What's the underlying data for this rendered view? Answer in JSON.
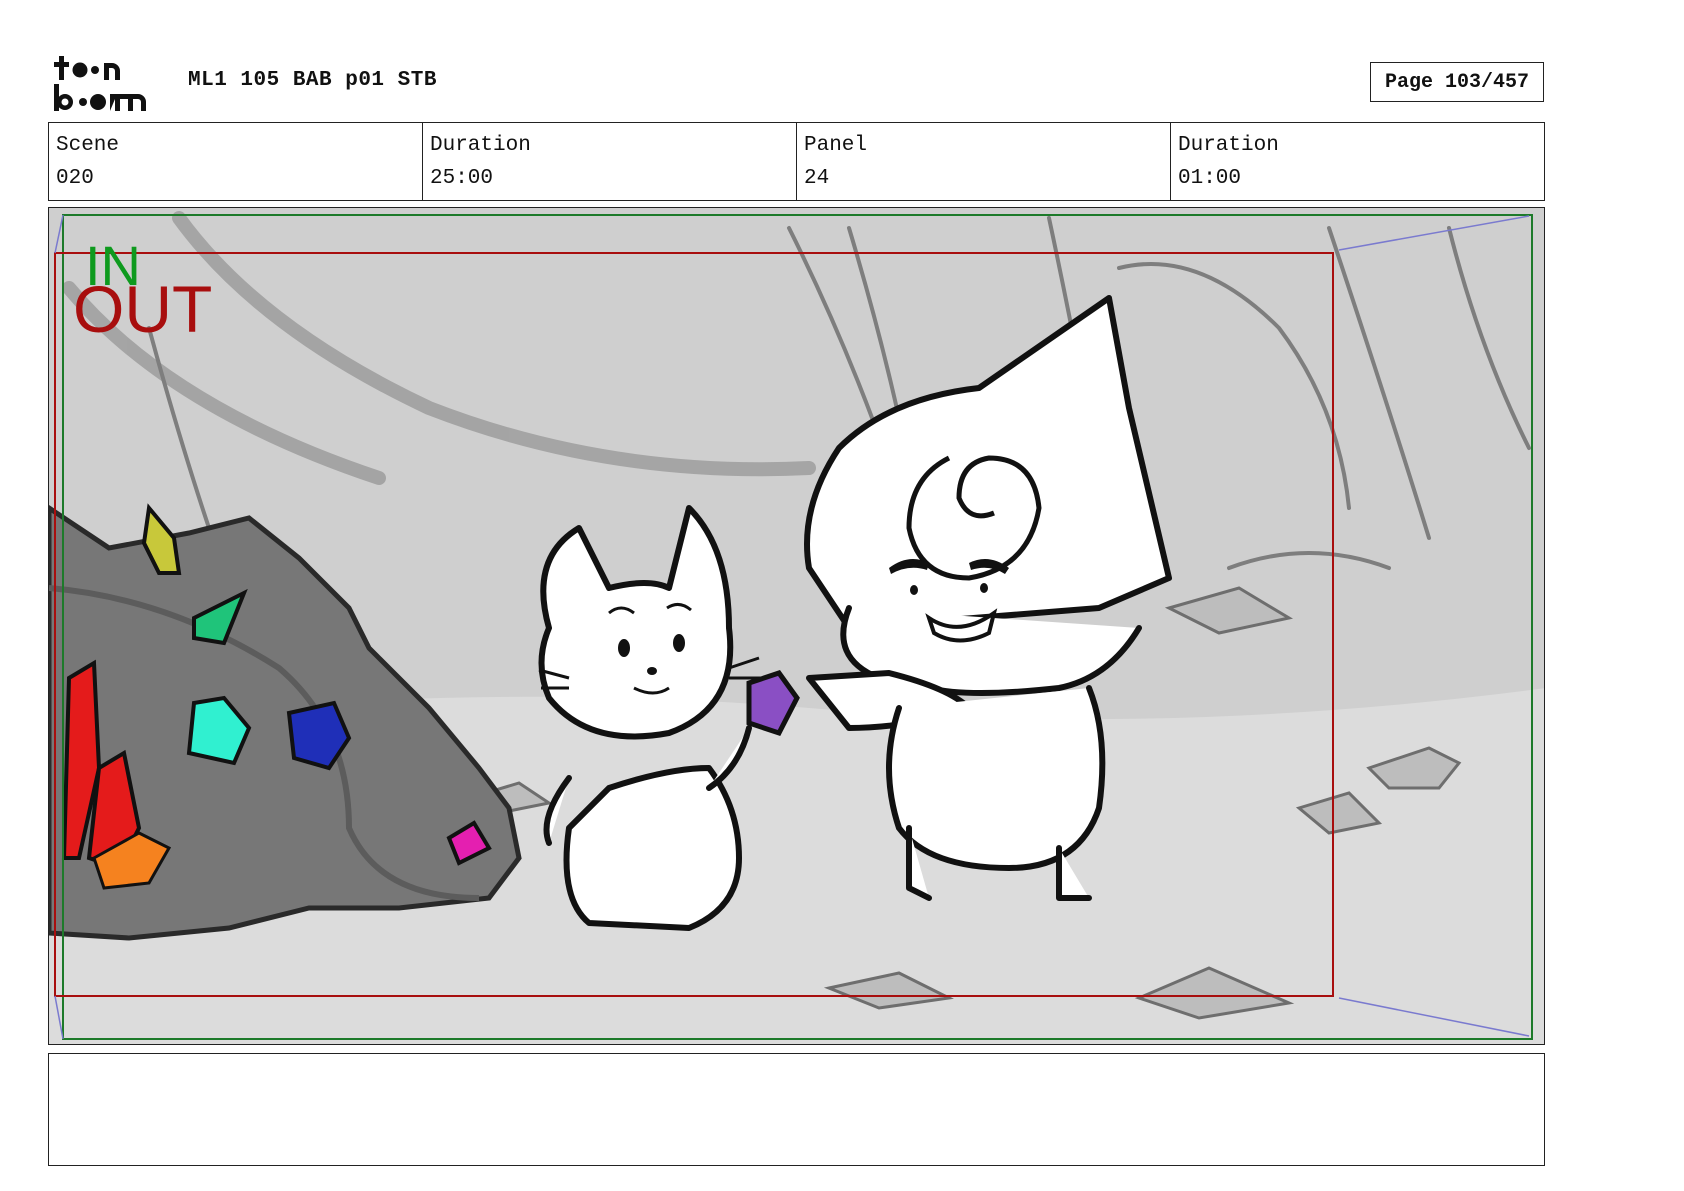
{
  "header": {
    "logo_text": "toon boom",
    "document_title": "ML1 105 BAB p01 STB",
    "page_label": "Page 103/457"
  },
  "info": {
    "scene_label": "Scene",
    "scene_value": "020",
    "scene_duration_label": "Duration",
    "scene_duration_value": "25:00",
    "panel_label": "Panel",
    "panel_value": "24",
    "panel_duration_label": "Duration",
    "panel_duration_value": "01:00"
  },
  "panel": {
    "in_marker": "IN",
    "out_marker": "OUT",
    "in_frame_color": "#0e9a1e",
    "out_frame_color": "#a80e0e"
  },
  "notes": {
    "text": ""
  }
}
